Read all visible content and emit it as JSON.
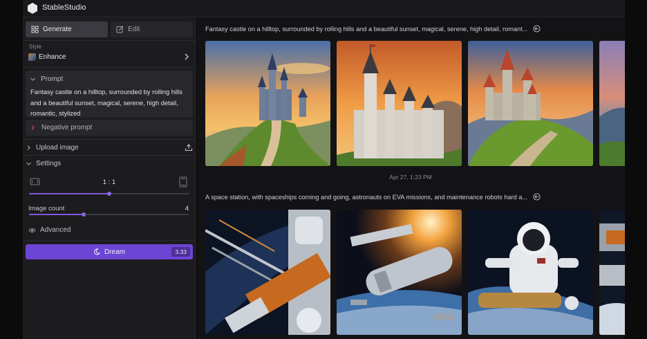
{
  "app": {
    "title": "StableStudio"
  },
  "sidebar": {
    "tabs": [
      {
        "label": "Generate",
        "active": true,
        "icon": "grid-icon"
      },
      {
        "label": "Edit",
        "active": false,
        "icon": "edit-icon"
      }
    ],
    "style": {
      "label": "Style",
      "value": "Enhance"
    },
    "prompt": {
      "label": "Prompt",
      "text": "Fantasy castle on a hilltop, surrounded by rolling hills and a beautiful sunset, magical, serene, high detail, romantic, stylized"
    },
    "negative_prompt": {
      "label": "Negative prompt"
    },
    "upload_image": {
      "label": "Upload image"
    },
    "settings": {
      "label": "Settings",
      "aspect_ratio": {
        "value": "1 : 1",
        "position": 0.5
      },
      "image_count": {
        "label": "Image count",
        "value": "4",
        "position": 0.34
      }
    },
    "advanced": {
      "label": "Advanced"
    },
    "dream": {
      "label": "Dream",
      "cost": "3.33"
    }
  },
  "main": {
    "generations": [
      {
        "prompt": "Fantasy castle on a hilltop, surrounded by rolling hills and a beautiful sunset, magical, serene, high detail, romant...",
        "images": [
          "castle-image-1",
          "castle-image-2",
          "castle-image-3",
          "castle-image-4"
        ]
      },
      {
        "timestamp": "Apr 27, 1:23 PM",
        "prompt": "A space station, with spaceships coming and going, astronauts on EVA missions, and maintenance robots hard a...",
        "images": [
          "space-image-1",
          "space-image-2",
          "space-image-3",
          "space-image-4"
        ]
      }
    ]
  },
  "colors": {
    "accent": "#6b46d4",
    "sidebar_bg": "#1c1c1f",
    "main_bg": "#131315"
  }
}
